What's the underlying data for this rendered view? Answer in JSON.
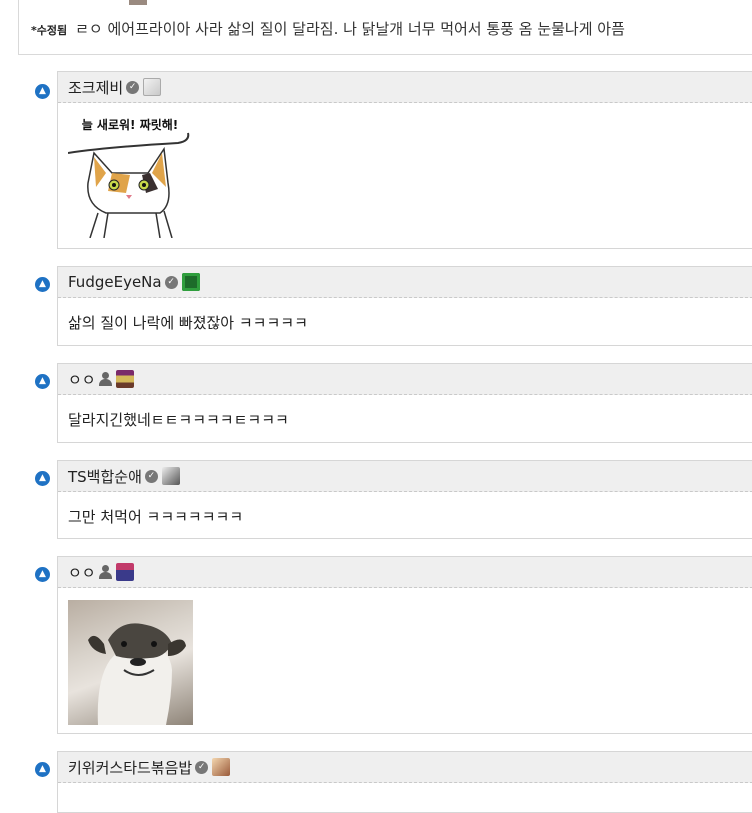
{
  "top_comment": {
    "edited_label": "*수정됨",
    "text": "ㄹㅇ 에어프라이아 사라 삶의 질이 달라짐. 나 닭날개 너무 먹어서 통풍 옴 눈물나게 아픔"
  },
  "replies": [
    {
      "nickname": "조크제비",
      "badge": "scroll-icon",
      "content_type": "image",
      "image_caption": "늘 새로워! 짜릿해!"
    },
    {
      "nickname": "FudgeEyeNa",
      "badge": "frog-icon",
      "content_type": "text",
      "text": "삶의 질이 나락에 빠졌잖아 ㅋㅋㅋㅋㅋ"
    },
    {
      "nickname": "ㅇㅇ",
      "badge": "pixel-character-icon",
      "content_type": "text",
      "text": "달라지긴했네ㅌㅌㅋㅋㅋㅋㅌㅋㅋㅋ"
    },
    {
      "nickname": "TS백합순애",
      "badge": "photo-icon",
      "content_type": "text",
      "text": "그만 처먹어 ㅋㅋㅋㅋㅋㅋㅋ"
    },
    {
      "nickname": "ㅇㅇ",
      "badge": "pixel-car-icon",
      "content_type": "image"
    },
    {
      "nickname": "키위커스타드볶음밥",
      "badge": "photo-icon",
      "content_type": "text",
      "text": ""
    }
  ],
  "icons": {
    "reply_arrow": "reply-arrow-icon",
    "verified": "verified-check-icon",
    "guest": "person-icon"
  },
  "colors": {
    "accent": "#1f72c4",
    "header_bg": "#efefef",
    "border": "#d6d6d6"
  }
}
